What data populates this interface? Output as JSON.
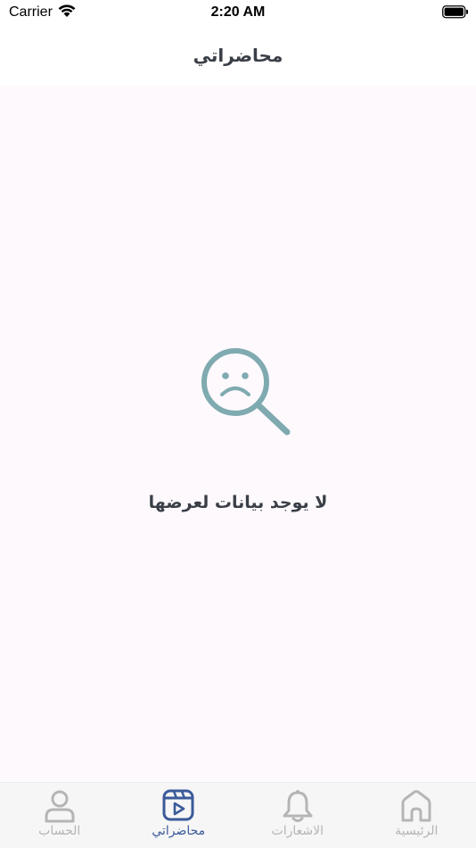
{
  "status_bar": {
    "carrier": "Carrier",
    "time": "2:20 AM",
    "icons": [
      "wifi-icon",
      "battery-icon"
    ]
  },
  "header": {
    "title": "محاضراتي"
  },
  "empty_state": {
    "icon": "sad-magnifier-icon",
    "message": "لا يوجد بيانات لعرضها",
    "icon_color": "#7faab0"
  },
  "tab_bar": {
    "active_color": "#3a5a9a",
    "inactive_color": "#b5b5b5",
    "tabs": [
      {
        "label": "الحساب",
        "icon": "user-icon",
        "active": false
      },
      {
        "label": "محاضراتي",
        "icon": "video-play-icon",
        "active": true
      },
      {
        "label": "الاشعارات",
        "icon": "bell-icon",
        "active": false
      },
      {
        "label": "الرئيسية",
        "icon": "home-icon",
        "active": false
      }
    ]
  }
}
